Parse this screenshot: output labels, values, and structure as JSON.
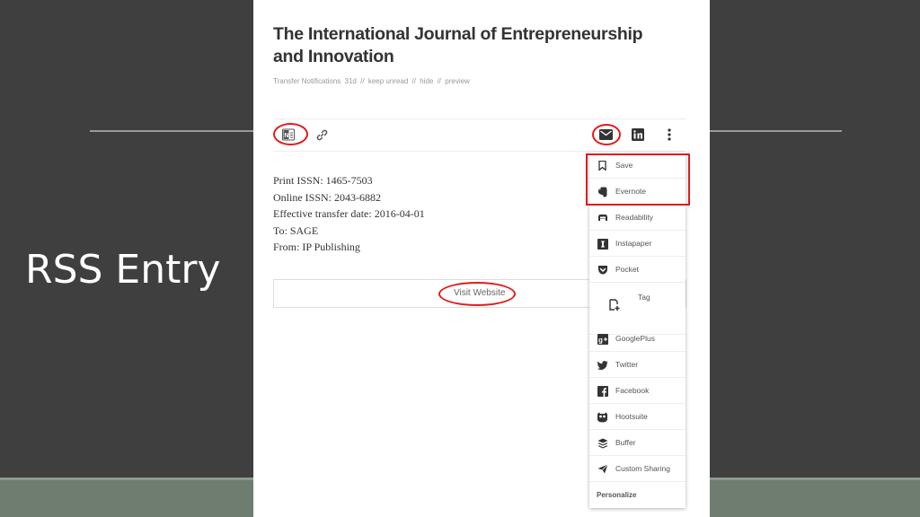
{
  "slide": {
    "title": "RSS Entry"
  },
  "article": {
    "title_line1": "The International Journal of Entrepreneurship",
    "title_line2": "and Innovation",
    "meta": {
      "source": "Transfer Notifications",
      "age": "31d",
      "separator": "//",
      "keep_unread": "keep unread",
      "hide": "hide",
      "preview": "preview"
    },
    "body": [
      "Print ISSN: 1465-7503",
      "Online ISSN: 2043-6882",
      "Effective transfer date: 2016-04-01",
      "To: SAGE",
      "From: IP Publishing"
    ],
    "visit_label": "Visit Website"
  },
  "toolbar": {
    "left_icons": [
      "onenote-icon",
      "link-icon"
    ],
    "right_icons": [
      "mail-icon",
      "linkedin-icon",
      "more-vertical-icon"
    ]
  },
  "share_menu": {
    "items": [
      {
        "label": "Save",
        "icon": "bookmark-icon"
      },
      {
        "label": "Evernote",
        "icon": "evernote-icon"
      },
      {
        "label": "Readability",
        "icon": "readability-icon"
      },
      {
        "label": "Instapaper",
        "icon": "instapaper-icon"
      },
      {
        "label": "Pocket",
        "icon": "pocket-icon"
      }
    ],
    "tag": {
      "label": "Tag",
      "icon": "tag-add-icon"
    },
    "social": [
      {
        "label": "GooglePlus",
        "icon": "googleplus-icon"
      },
      {
        "label": "Twitter",
        "icon": "twitter-icon"
      },
      {
        "label": "Facebook",
        "icon": "facebook-icon"
      },
      {
        "label": "Hootsuite",
        "icon": "hootsuite-icon"
      },
      {
        "label": "Buffer",
        "icon": "buffer-icon"
      },
      {
        "label": "Custom Sharing",
        "icon": "send-icon"
      }
    ],
    "personalize": "Personalize"
  },
  "colors": {
    "slide_background": "#3f3f3f",
    "slide_footer": "#6e7d70",
    "highlight": "#e01b1b",
    "panel": "#ffffff"
  }
}
